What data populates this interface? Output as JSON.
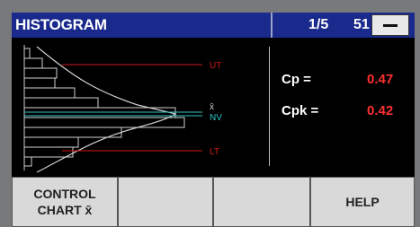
{
  "header": {
    "title": "HISTOGRAM",
    "page_indicator": "1/5",
    "count": "51"
  },
  "chart": {
    "upper_limit_label": "UT",
    "mean_label": "x̄",
    "nominal_label": "NV",
    "lower_limit_label": "LT"
  },
  "metrics": [
    {
      "label": "Cp =",
      "value": "0.47"
    },
    {
      "label": "Cpk =",
      "value": "0.42"
    }
  ],
  "softkeys": [
    {
      "label_line1": "CONTROL",
      "label_line2": "CHART x̄"
    },
    {
      "label_line1": "",
      "label_line2": ""
    },
    {
      "label_line1": "",
      "label_line2": ""
    },
    {
      "label_line1": "HELP",
      "label_line2": ""
    }
  ],
  "colors": {
    "title_bg": "#1a2a8c",
    "limit_line": "#d01818",
    "mean_line": "#2ec4c4",
    "value_red": "#ff3030"
  }
}
